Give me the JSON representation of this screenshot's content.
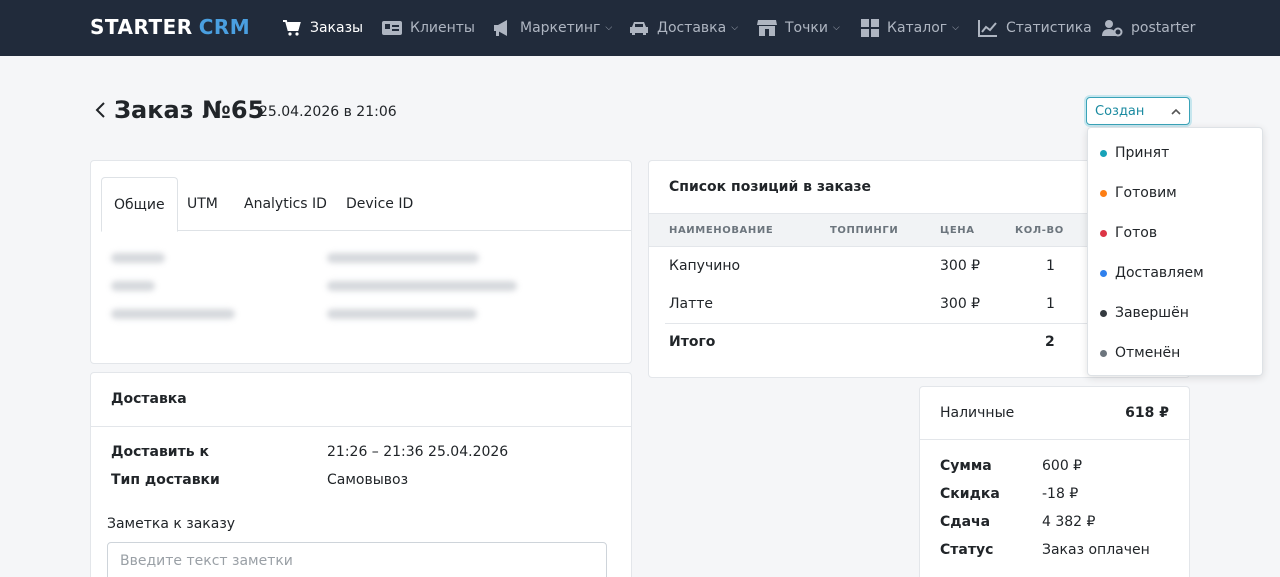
{
  "navbar": {
    "brand_main": "STARTER",
    "brand_accent": "CRM",
    "items": [
      {
        "label": "Заказы",
        "icon": "cart-icon"
      },
      {
        "label": "Клиенты",
        "icon": "id-card-icon"
      },
      {
        "label": "Маркетинг",
        "icon": "megaphone-icon"
      },
      {
        "label": "Доставка",
        "icon": "car-icon"
      },
      {
        "label": "Точки",
        "icon": "store-icon"
      },
      {
        "label": "Каталог",
        "icon": "grid-icon"
      },
      {
        "label": "Статистика",
        "icon": "chart-icon"
      },
      {
        "label": "postarter",
        "icon": "user-gear-icon"
      }
    ]
  },
  "order": {
    "title": "Заказ №65",
    "date": "25.04.2026 в 21:06"
  },
  "status": {
    "selected": "Создан",
    "options": [
      {
        "label": "Принят",
        "color": "#17a2b8"
      },
      {
        "label": "Готовим",
        "color": "#fd7e14"
      },
      {
        "label": "Готов",
        "color": "#dc3545"
      },
      {
        "label": "Доставляем",
        "color": "#2f80ed"
      },
      {
        "label": "Завершён",
        "color": "#343a40"
      },
      {
        "label": "Отменён",
        "color": "#6c757d"
      }
    ]
  },
  "info_tabs": [
    "Общие",
    "UTM",
    "Analytics ID",
    "Device ID"
  ],
  "delivery": {
    "title": "Доставка",
    "deliver_at_label": "Доставить к",
    "deliver_at_value": "21:26 – 21:36  25.04.2026",
    "type_label": "Тип доставки",
    "type_value": "Самовывоз",
    "note_label": "Заметка к заказу",
    "note_placeholder": "Введите текст заметки"
  },
  "items": {
    "title": "Список позиций в заказе",
    "columns": [
      "НАИМЕНОВАНИЕ",
      "ТОППИНГИ",
      "ЦЕНА",
      "КОЛ-ВО"
    ],
    "rows": [
      {
        "name": "Капучино",
        "price": "300 ₽",
        "qty": "1"
      },
      {
        "name": "Латте",
        "price": "300 ₽",
        "qty": "1"
      }
    ],
    "total_label": "Итого",
    "total_qty": "2"
  },
  "payment": {
    "method": "Наличные",
    "method_amount": "618 ₽",
    "rows": [
      {
        "label": "Сумма",
        "value": "600 ₽"
      },
      {
        "label": "Скидка",
        "value": "-18 ₽"
      },
      {
        "label": "Сдача",
        "value": "4 382 ₽"
      },
      {
        "label": "Статус",
        "value": "Заказ оплачен"
      }
    ]
  }
}
